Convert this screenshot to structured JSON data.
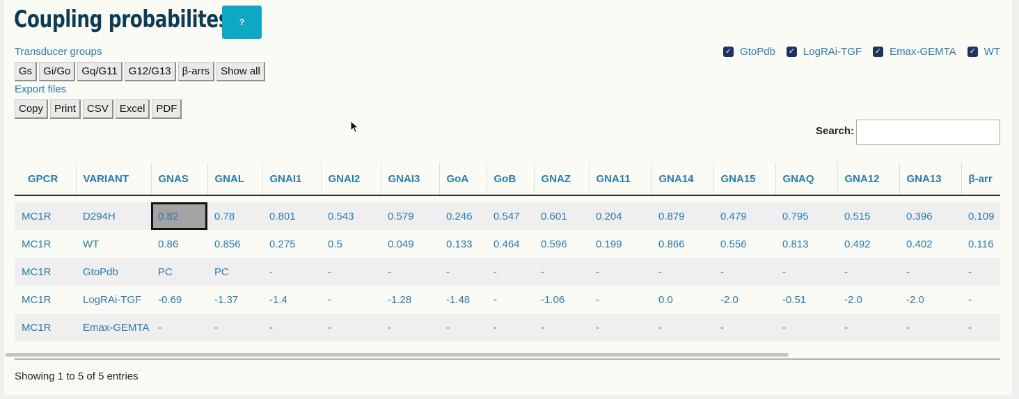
{
  "title": "Coupling probabilites",
  "help_button": "?",
  "transducer_groups": {
    "label": "Transducer groups",
    "buttons": [
      "Gs",
      "Gi/Go",
      "Gq/G11",
      "G12/G13",
      "β-arrs",
      "Show all"
    ]
  },
  "export_files": {
    "label": "Export files",
    "buttons": [
      "Copy",
      "Print",
      "CSV",
      "Excel",
      "PDF"
    ]
  },
  "filters": [
    {
      "label": "GtoPdb",
      "checked": true
    },
    {
      "label": "LogRAi-TGF",
      "checked": true
    },
    {
      "label": "Emax-GEMTA",
      "checked": true
    },
    {
      "label": "WT",
      "checked": true
    }
  ],
  "search": {
    "label": "Search:",
    "value": "",
    "placeholder": ""
  },
  "table": {
    "columns": [
      "GPCR",
      "VARIANT",
      "GNAS",
      "GNAL",
      "GNAI1",
      "GNAI2",
      "GNAI3",
      "GoA",
      "GoB",
      "GNAZ",
      "GNA11",
      "GNA14",
      "GNA15",
      "GNAQ",
      "GNA12",
      "GNA13",
      "β-arr"
    ],
    "rows": [
      [
        "MC1R",
        "D294H",
        "0.82",
        "0.78",
        "0.801",
        "0.543",
        "0.579",
        "0.246",
        "0.547",
        "0.601",
        "0.204",
        "0.879",
        "0.479",
        "0.795",
        "0.515",
        "0.396",
        "0.109"
      ],
      [
        "MC1R",
        "WT",
        "0.86",
        "0.856",
        "0.275",
        "0.5",
        "0.049",
        "0.133",
        "0.464",
        "0.596",
        "0.199",
        "0.866",
        "0.556",
        "0.813",
        "0.492",
        "0.402",
        "0.116"
      ],
      [
        "MC1R",
        "GtoPdb",
        "PC",
        "PC",
        "-",
        "-",
        "-",
        "-",
        "-",
        "-",
        "-",
        "-",
        "-",
        "-",
        "-",
        "-",
        "-"
      ],
      [
        "MC1R",
        "LogRAi-TGF",
        "-0.69",
        "-1.37",
        "-1.4",
        "-",
        "-1.28",
        "-1.48",
        "-",
        "-1.06",
        "-",
        "0.0",
        "-2.0",
        "-0.51",
        "-2.0",
        "-2.0",
        "-"
      ],
      [
        "MC1R",
        "Emax-GEMTA",
        "-",
        "-",
        "-",
        "-",
        "-",
        "-",
        "-",
        "-",
        "-",
        "-",
        "-",
        "-",
        "-",
        "-",
        "-"
      ]
    ],
    "focused_cell": {
      "row": 0,
      "col": 2
    }
  },
  "info": "Showing 1 to 5 of 5 entries",
  "colors": {
    "title": "#0d3b55",
    "link": "#2a7ab0",
    "help_button": "#0fa8c4",
    "checkbox": "#20335f"
  },
  "icons": {
    "checkbox": "check-icon",
    "cursor": "mouse-cursor-icon"
  }
}
